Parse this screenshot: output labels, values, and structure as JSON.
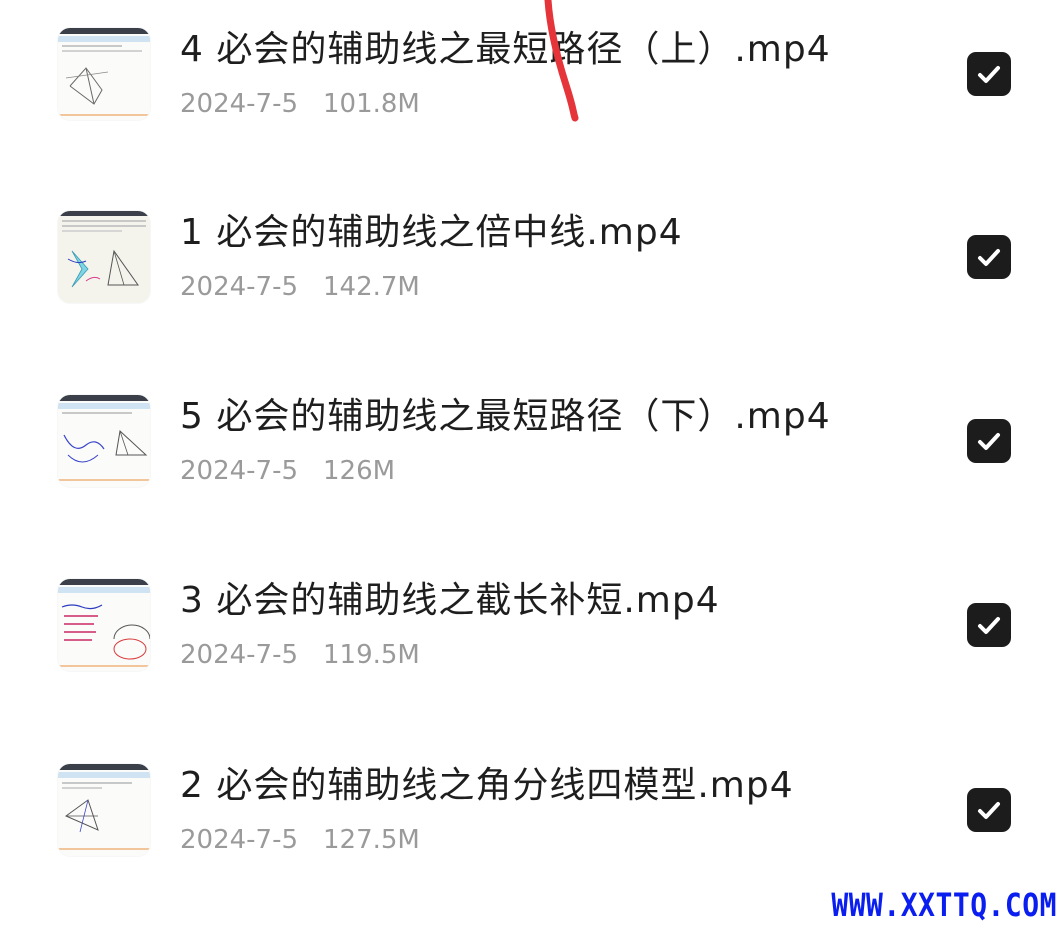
{
  "files": [
    {
      "name": "4 必会的辅助线之最短路径（上）.mp4",
      "date": "2024-7-5",
      "size": "101.8M",
      "checked": true,
      "thumbnail": "geometry-notes-thumbnail"
    },
    {
      "name": "1 必会的辅助线之倍中线.mp4",
      "date": "2024-7-5",
      "size": "142.7M",
      "checked": true,
      "thumbnail": "geometry-notes-thumbnail"
    },
    {
      "name": "5 必会的辅助线之最短路径（下）.mp4",
      "date": "2024-7-5",
      "size": "126M",
      "checked": true,
      "thumbnail": "geometry-notes-thumbnail"
    },
    {
      "name": "3 必会的辅助线之截长补短.mp4",
      "date": "2024-7-5",
      "size": "119.5M",
      "checked": true,
      "thumbnail": "geometry-notes-thumbnail"
    },
    {
      "name": "2 必会的辅助线之角分线四模型.mp4",
      "date": "2024-7-5",
      "size": "127.5M",
      "checked": true,
      "thumbnail": "geometry-notes-thumbnail"
    }
  ],
  "watermark": "WWW.XXTTQ.COM",
  "colors": {
    "checkbox": "#1c1c1c",
    "meta_text": "#9a9a9a",
    "pen_stroke": "#e5353a",
    "watermark": "#0a1ef0"
  }
}
